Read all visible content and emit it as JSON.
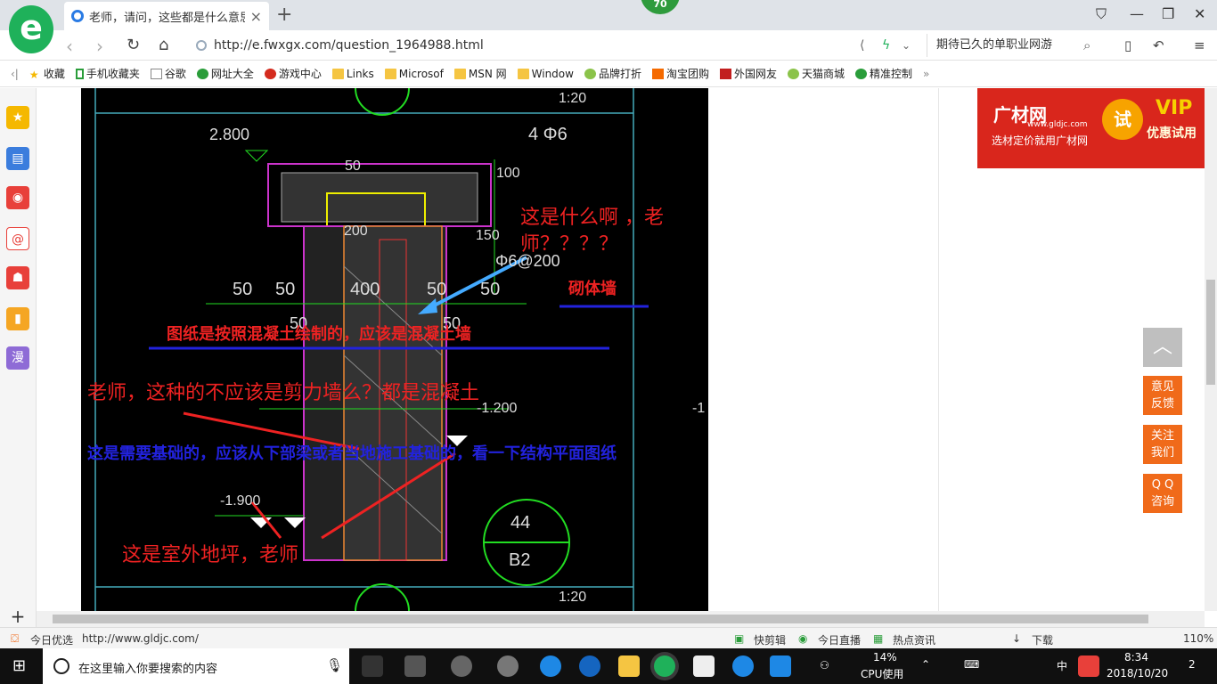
{
  "browser": {
    "tab_title": "老师，请问，这些都是什么意思啊",
    "badge": "70",
    "url": "http://e.fwxgx.com/question_1964988.html",
    "promo_text": "期待已久的单职业网游"
  },
  "bookmarks": [
    "收藏",
    "手机收藏夹",
    "谷歌",
    "网址大全",
    "游戏中心",
    "Links",
    "Microsof",
    "MSN 网",
    "Window",
    "品牌打折",
    "淘宝团购",
    "外国网友",
    "天猫商城",
    "精准控制"
  ],
  "cad": {
    "dims": [
      "2.800",
      "4 Φ6",
      "50",
      "100",
      "200",
      "150",
      "Φ6@200",
      "50",
      "50",
      "400",
      "50",
      "50",
      "50",
      "50",
      "-1.200",
      "-1.900",
      "44",
      "B2",
      "1:20",
      "1:20",
      "-1"
    ],
    "annotations": {
      "q1": "这是什么啊 ，老",
      "q1b": "师？？？？",
      "wall": "砌体墙",
      "answer1": "图纸是按照混凝土绘制的，应该是混凝土墙",
      "q2": "老师，这种的不应该是剪力墙么？都是混凝土",
      "answer2": "这是需要基础的，应该从下部梁或者当地施工基础的，看一下结构平面图纸",
      "q3": "这是室外地坪，老师"
    }
  },
  "ad": {
    "brand": "广材网",
    "site": "www.gldjc.com",
    "slogan": "选材定价就用广材网",
    "try": "试",
    "vip": "VIP",
    "vip_sub": "优惠试用"
  },
  "float": {
    "feedback": [
      "意见",
      "反馈"
    ],
    "follow": [
      "关注",
      "我们"
    ],
    "qq": [
      "Q Q",
      "咨询"
    ]
  },
  "status": {
    "today": "今日优选",
    "url": "http://www.gldjc.com/",
    "items": [
      "快剪辑",
      "今日直播",
      "热点资讯",
      "下载",
      "110%"
    ]
  },
  "taskbar": {
    "search_placeholder": "在这里输入你要搜索的内容",
    "cpu_pct": "14%",
    "cpu_label": "CPU使用",
    "ime": "中",
    "time": "8:34",
    "date": "2018/10/20",
    "notif": "2"
  }
}
